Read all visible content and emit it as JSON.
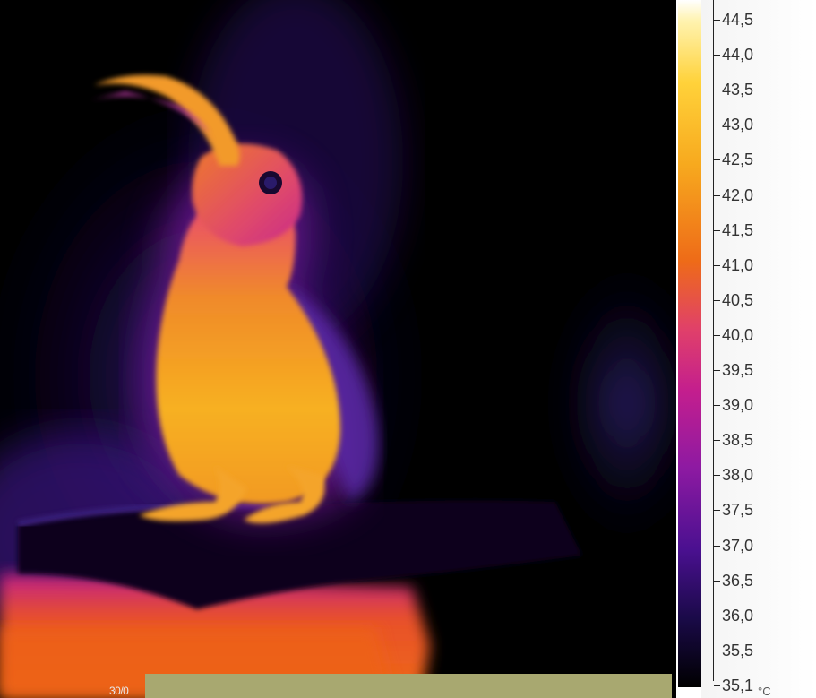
{
  "image": {
    "description_tags": [
      "thermal-image",
      "bird",
      "perch"
    ]
  },
  "scale": {
    "ticks": [
      "44,5",
      "44,0",
      "43,5",
      "43,0",
      "42,5",
      "42,0",
      "41,5",
      "41,0",
      "40,5",
      "40,0",
      "39,5",
      "39,0",
      "38,5",
      "38,0",
      "37,5",
      "37,0",
      "36,5",
      "36,0",
      "35,5",
      "35,1"
    ],
    "unit": "°C"
  },
  "overlay": {
    "corner_text": "30/0"
  },
  "colors": {
    "hot": "#ffd23a",
    "warm": "#ee6b18",
    "mid": "#c31e8e",
    "cool": "#4a1090",
    "cold": "#000000"
  }
}
